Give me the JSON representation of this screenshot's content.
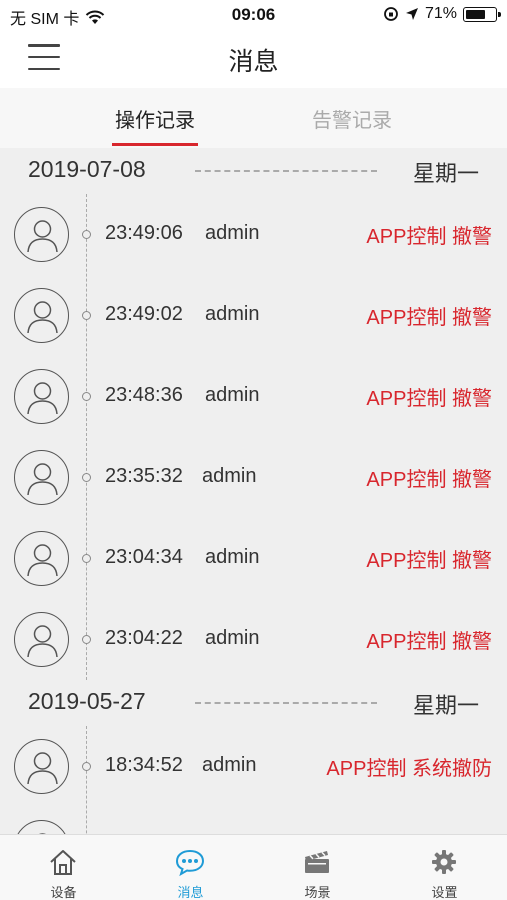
{
  "status_bar": {
    "carrier": "无 SIM 卡",
    "time": "09:06",
    "battery_percent": "71%",
    "battery_level": 0.71
  },
  "nav": {
    "title": "消息",
    "menu_icon": "hamburger-menu-icon"
  },
  "tabs": [
    {
      "label": "操作记录",
      "active": true
    },
    {
      "label": "告警记录",
      "active": false
    }
  ],
  "groups": [
    {
      "date": "2019-07-08",
      "weekday": "星期一",
      "records": [
        {
          "time": "23:49:06",
          "user": "admin",
          "action": "APP控制 撤警"
        },
        {
          "time": "23:49:02",
          "user": "admin",
          "action": "APP控制 撤警"
        },
        {
          "time": "23:48:36",
          "user": "admin",
          "action": "APP控制 撤警"
        },
        {
          "time": "23:35:32",
          "user": "admin",
          "action": "APP控制 撤警"
        },
        {
          "time": "23:04:34",
          "user": "admin",
          "action": "APP控制 撤警"
        },
        {
          "time": "23:04:22",
          "user": "admin",
          "action": "APP控制 撤警"
        }
      ]
    },
    {
      "date": "2019-05-27",
      "weekday": "星期一",
      "records": [
        {
          "time": "18:34:52",
          "user": "admin",
          "action": "APP控制 系统撤防"
        }
      ]
    }
  ],
  "tab_bar": [
    {
      "label": "设备",
      "icon": "house-icon",
      "active": false
    },
    {
      "label": "消息",
      "icon": "chat-bubble-icon",
      "active": true
    },
    {
      "label": "场景",
      "icon": "clapperboard-icon",
      "active": false
    },
    {
      "label": "设置",
      "icon": "gear-icon",
      "active": false
    }
  ],
  "colors": {
    "accent_red": "#d8262d",
    "active_blue": "#1f9bd6"
  }
}
